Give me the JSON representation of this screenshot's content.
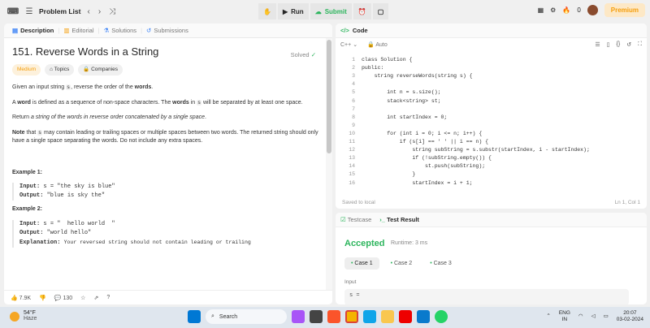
{
  "header": {
    "problem_list": "Problem List",
    "run": "Run",
    "submit": "Submit",
    "streak": "0",
    "premium": "Premium"
  },
  "left_tabs": [
    {
      "label": "Description"
    },
    {
      "label": "Editorial"
    },
    {
      "label": "Solutions"
    },
    {
      "label": "Submissions"
    }
  ],
  "problem": {
    "title": "151. Reverse Words in a String",
    "status": "Solved",
    "difficulty": "Medium",
    "topics": "Topics",
    "companies": "Companies"
  },
  "description": {
    "p1a": "Given an input string ",
    "p1b": "s",
    "p1c": ", reverse the order of the ",
    "p1d": "words",
    "p1e": ".",
    "p2a": "A ",
    "p2b": "word",
    "p2c": " is defined as a sequence of non-space characters. The ",
    "p2d": "words",
    "p2e": " in ",
    "p2f": "s",
    "p2g": " will be separated by at least one space.",
    "p3a": "Return ",
    "p3b": "a string of the words in reverse order concatenated by a single space",
    ".": ".",
    "p3c": ".",
    "p4a": "Note",
    "p4b": " that ",
    "p4c": "s",
    "p4d": " may contain leading or trailing spaces or multiple spaces between two words. The returned string should only have a single space separating the words. Do not include any extra spaces."
  },
  "examples": [
    {
      "title": "Example 1:",
      "input": "s = \"the sky is blue\"",
      "output": "\"blue is sky the\""
    },
    {
      "title": "Example 2:",
      "input": "s = \"  hello world  \"",
      "output": "\"world hello\"",
      "explanation": "Your reversed string should not contain leading or trailing"
    }
  ],
  "labels": {
    "input": "Input:",
    "output": "Output:",
    "explanation": "Explanation:"
  },
  "bottom_bar": {
    "likes": "7.9K",
    "comments": "130"
  },
  "code_panel": {
    "title": "Code",
    "language": "C++",
    "mode": "Auto",
    "saved": "Saved to local",
    "cursor": "Ln 1, Col 1"
  },
  "code_lines": [
    "class Solution {",
    "public:",
    "    string reverseWords(string s) {",
    "",
    "        int n = s.size();",
    "        stack<string> st;",
    "",
    "        int startIndex = 0;",
    "",
    "        for (int i = 0; i <= n; i++) {",
    "            if (s[i] == ' ' || i == n) {",
    "                string subString = s.substr(startIndex, i - startIndex);",
    "                if (!subString.empty()) {",
    "                    st.push(subString);",
    "                }",
    "                startIndex = i + 1;"
  ],
  "result_panel": {
    "tab1": "Testcase",
    "tab2": "Test Result",
    "status": "Accepted",
    "runtime": "Runtime: 3 ms",
    "cases": [
      "Case 1",
      "Case 2",
      "Case 3"
    ],
    "input_label": "Input",
    "input_value": "s ="
  },
  "taskbar": {
    "temp": "54°F",
    "weather": "Haze",
    "search": "Search",
    "lang": "ENG",
    "region": "IN",
    "time": "20:07",
    "date": "03-02-2024",
    "badge": "1"
  }
}
